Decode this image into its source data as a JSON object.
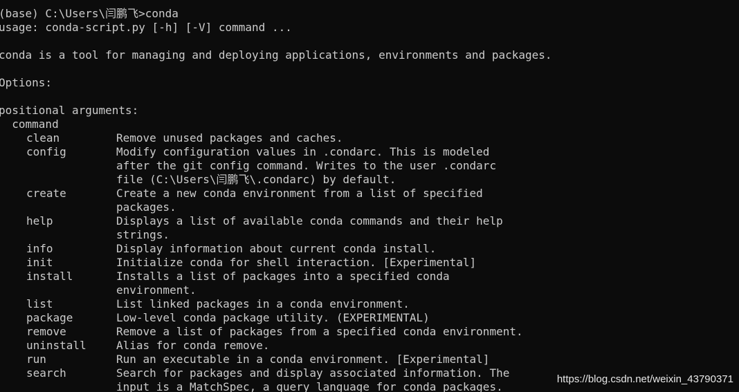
{
  "terminal": {
    "background": "#0c0c0c",
    "foreground": "#cccccc",
    "prompt_line": "(base) C:\\Users\\闫鹏飞>conda",
    "usage_line": "usage: conda-script.py [-h] [-V] command ...",
    "description_line": "conda is a tool for managing and deploying applications, environments and packages.",
    "options_heading": "Options:",
    "positional_heading": "positional arguments:",
    "command_label": "  command",
    "commands": [
      {
        "name": "clean",
        "desc": [
          "Remove unused packages and caches."
        ]
      },
      {
        "name": "config",
        "desc": [
          "Modify configuration values in .condarc. This is modeled",
          "after the git config command. Writes to the user .condarc",
          "file (C:\\Users\\闫鹏飞\\.condarc) by default."
        ]
      },
      {
        "name": "create",
        "desc": [
          "Create a new conda environment from a list of specified",
          "packages."
        ]
      },
      {
        "name": "help",
        "desc": [
          "Displays a list of available conda commands and their help",
          "strings."
        ]
      },
      {
        "name": "info",
        "desc": [
          "Display information about current conda install."
        ]
      },
      {
        "name": "init",
        "desc": [
          "Initialize conda for shell interaction. [Experimental]"
        ]
      },
      {
        "name": "install",
        "desc": [
          "Installs a list of packages into a specified conda",
          "environment."
        ]
      },
      {
        "name": "list",
        "desc": [
          "List linked packages in a conda environment."
        ]
      },
      {
        "name": "package",
        "desc": [
          "Low-level conda package utility. (EXPERIMENTAL)"
        ]
      },
      {
        "name": "remove",
        "desc": [
          "Remove a list of packages from a specified conda environment."
        ]
      },
      {
        "name": "uninstall",
        "desc": [
          "Alias for conda remove."
        ]
      },
      {
        "name": "run",
        "desc": [
          "Run an executable in a conda environment. [Experimental]"
        ]
      },
      {
        "name": "search",
        "desc": [
          "Search for packages and display associated information. The",
          "input is a MatchSpec, a query language for conda packages."
        ]
      }
    ]
  },
  "watermark": "https://blog.csdn.net/weixin_43790371"
}
